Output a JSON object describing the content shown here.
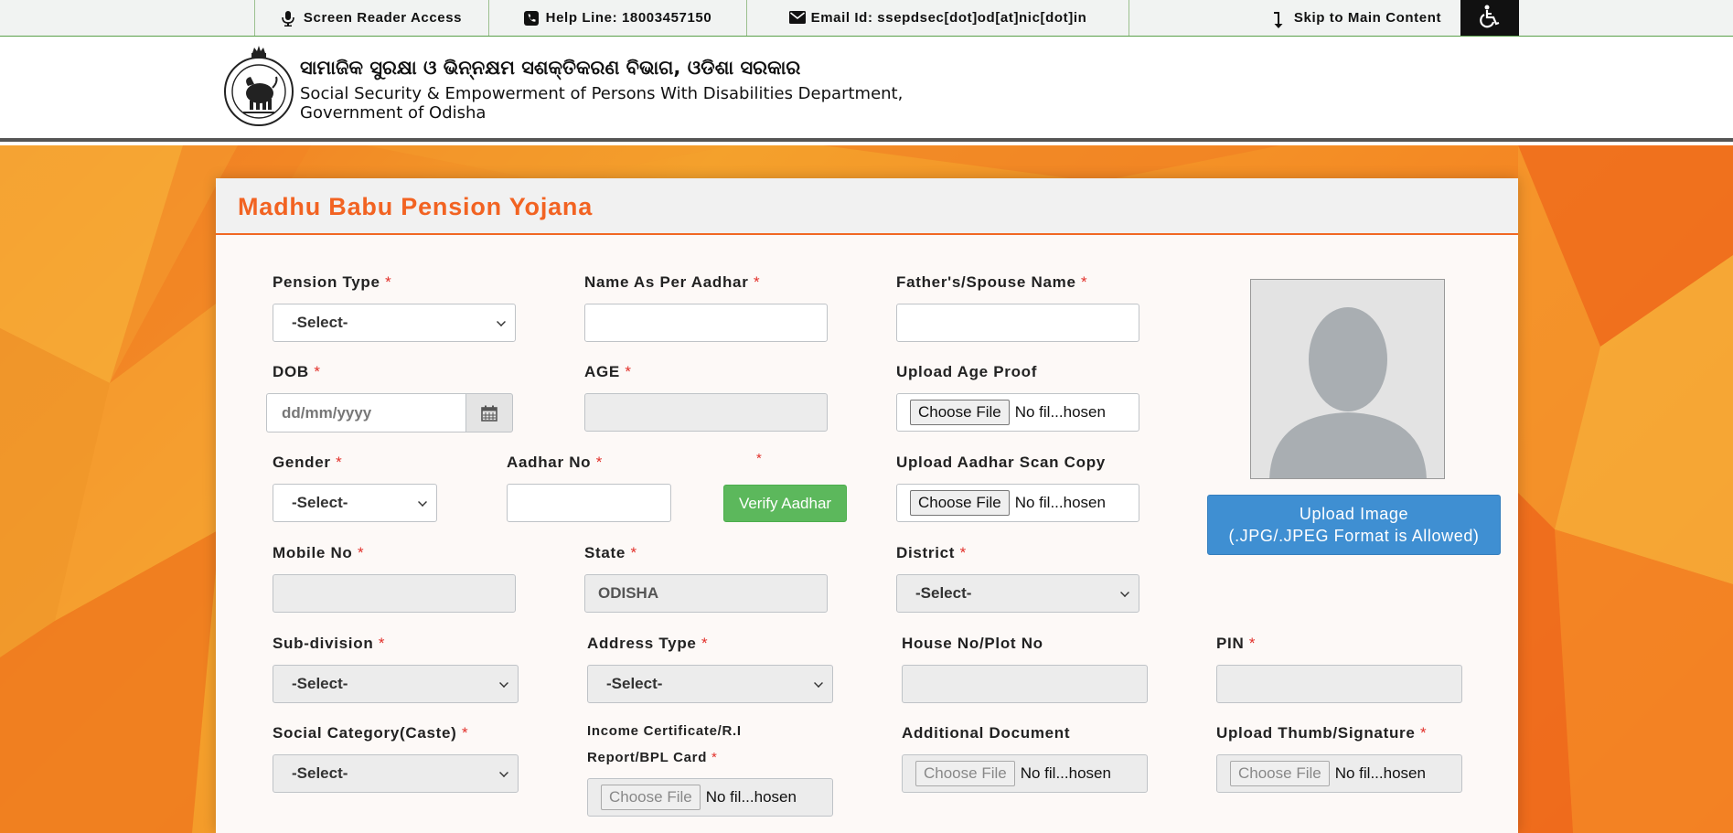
{
  "topbar": {
    "screen_reader": "Screen Reader Access",
    "help_line": "Help Line: 18003457150",
    "email": "Email Id: ssepdsec[dot]od[at]nic[dot]in",
    "skip": "Skip to Main Content"
  },
  "header": {
    "odia_title": "ସାମାଜିକ ସୁରକ୍ଷା ଓ ଭିନ୍ନକ୍ଷମ ସଶକ୍ତିକରଣ ବିଭାଗ, ଓଡିଶା ସରକାର",
    "en_line1": "Social Security & Empowerment of Persons With Disabilities Department,",
    "en_line2": "Government of Odisha"
  },
  "form": {
    "title": "Madhu Babu Pension Yojana",
    "required_mark": "*",
    "select_placeholder": "-Select-",
    "file_button": "Choose File",
    "file_status": "No fil...hosen",
    "labels": {
      "pension_type": "Pension Type",
      "name_aadhar": "Name As Per Aadhar",
      "father_spouse": "Father's/Spouse Name",
      "dob": "DOB",
      "age": "AGE",
      "age_proof": "Upload Age Proof",
      "gender": "Gender",
      "aadhar_no": "Aadhar No",
      "aadhar_scan": "Upload Aadhar Scan Copy",
      "mobile": "Mobile No",
      "state": "State",
      "district": "District",
      "subdivision": "Sub-division",
      "address_type": "Address Type",
      "house_no": "House No/Plot No",
      "pin": "PIN",
      "social_category": "Social Category(Caste)",
      "income_cert": "Income Certificate/R.I Report/BPL Card",
      "additional_doc": "Additional Document",
      "thumb_sig": "Upload Thumb/Signature"
    },
    "dob_placeholder": "dd/mm/yyyy",
    "state_value": "ODISHA",
    "verify_button": "Verify Aadhar",
    "upload_image_line1": "Upload Image",
    "upload_image_line2": "(.JPG/.JPEG Format is Allowed)"
  }
}
